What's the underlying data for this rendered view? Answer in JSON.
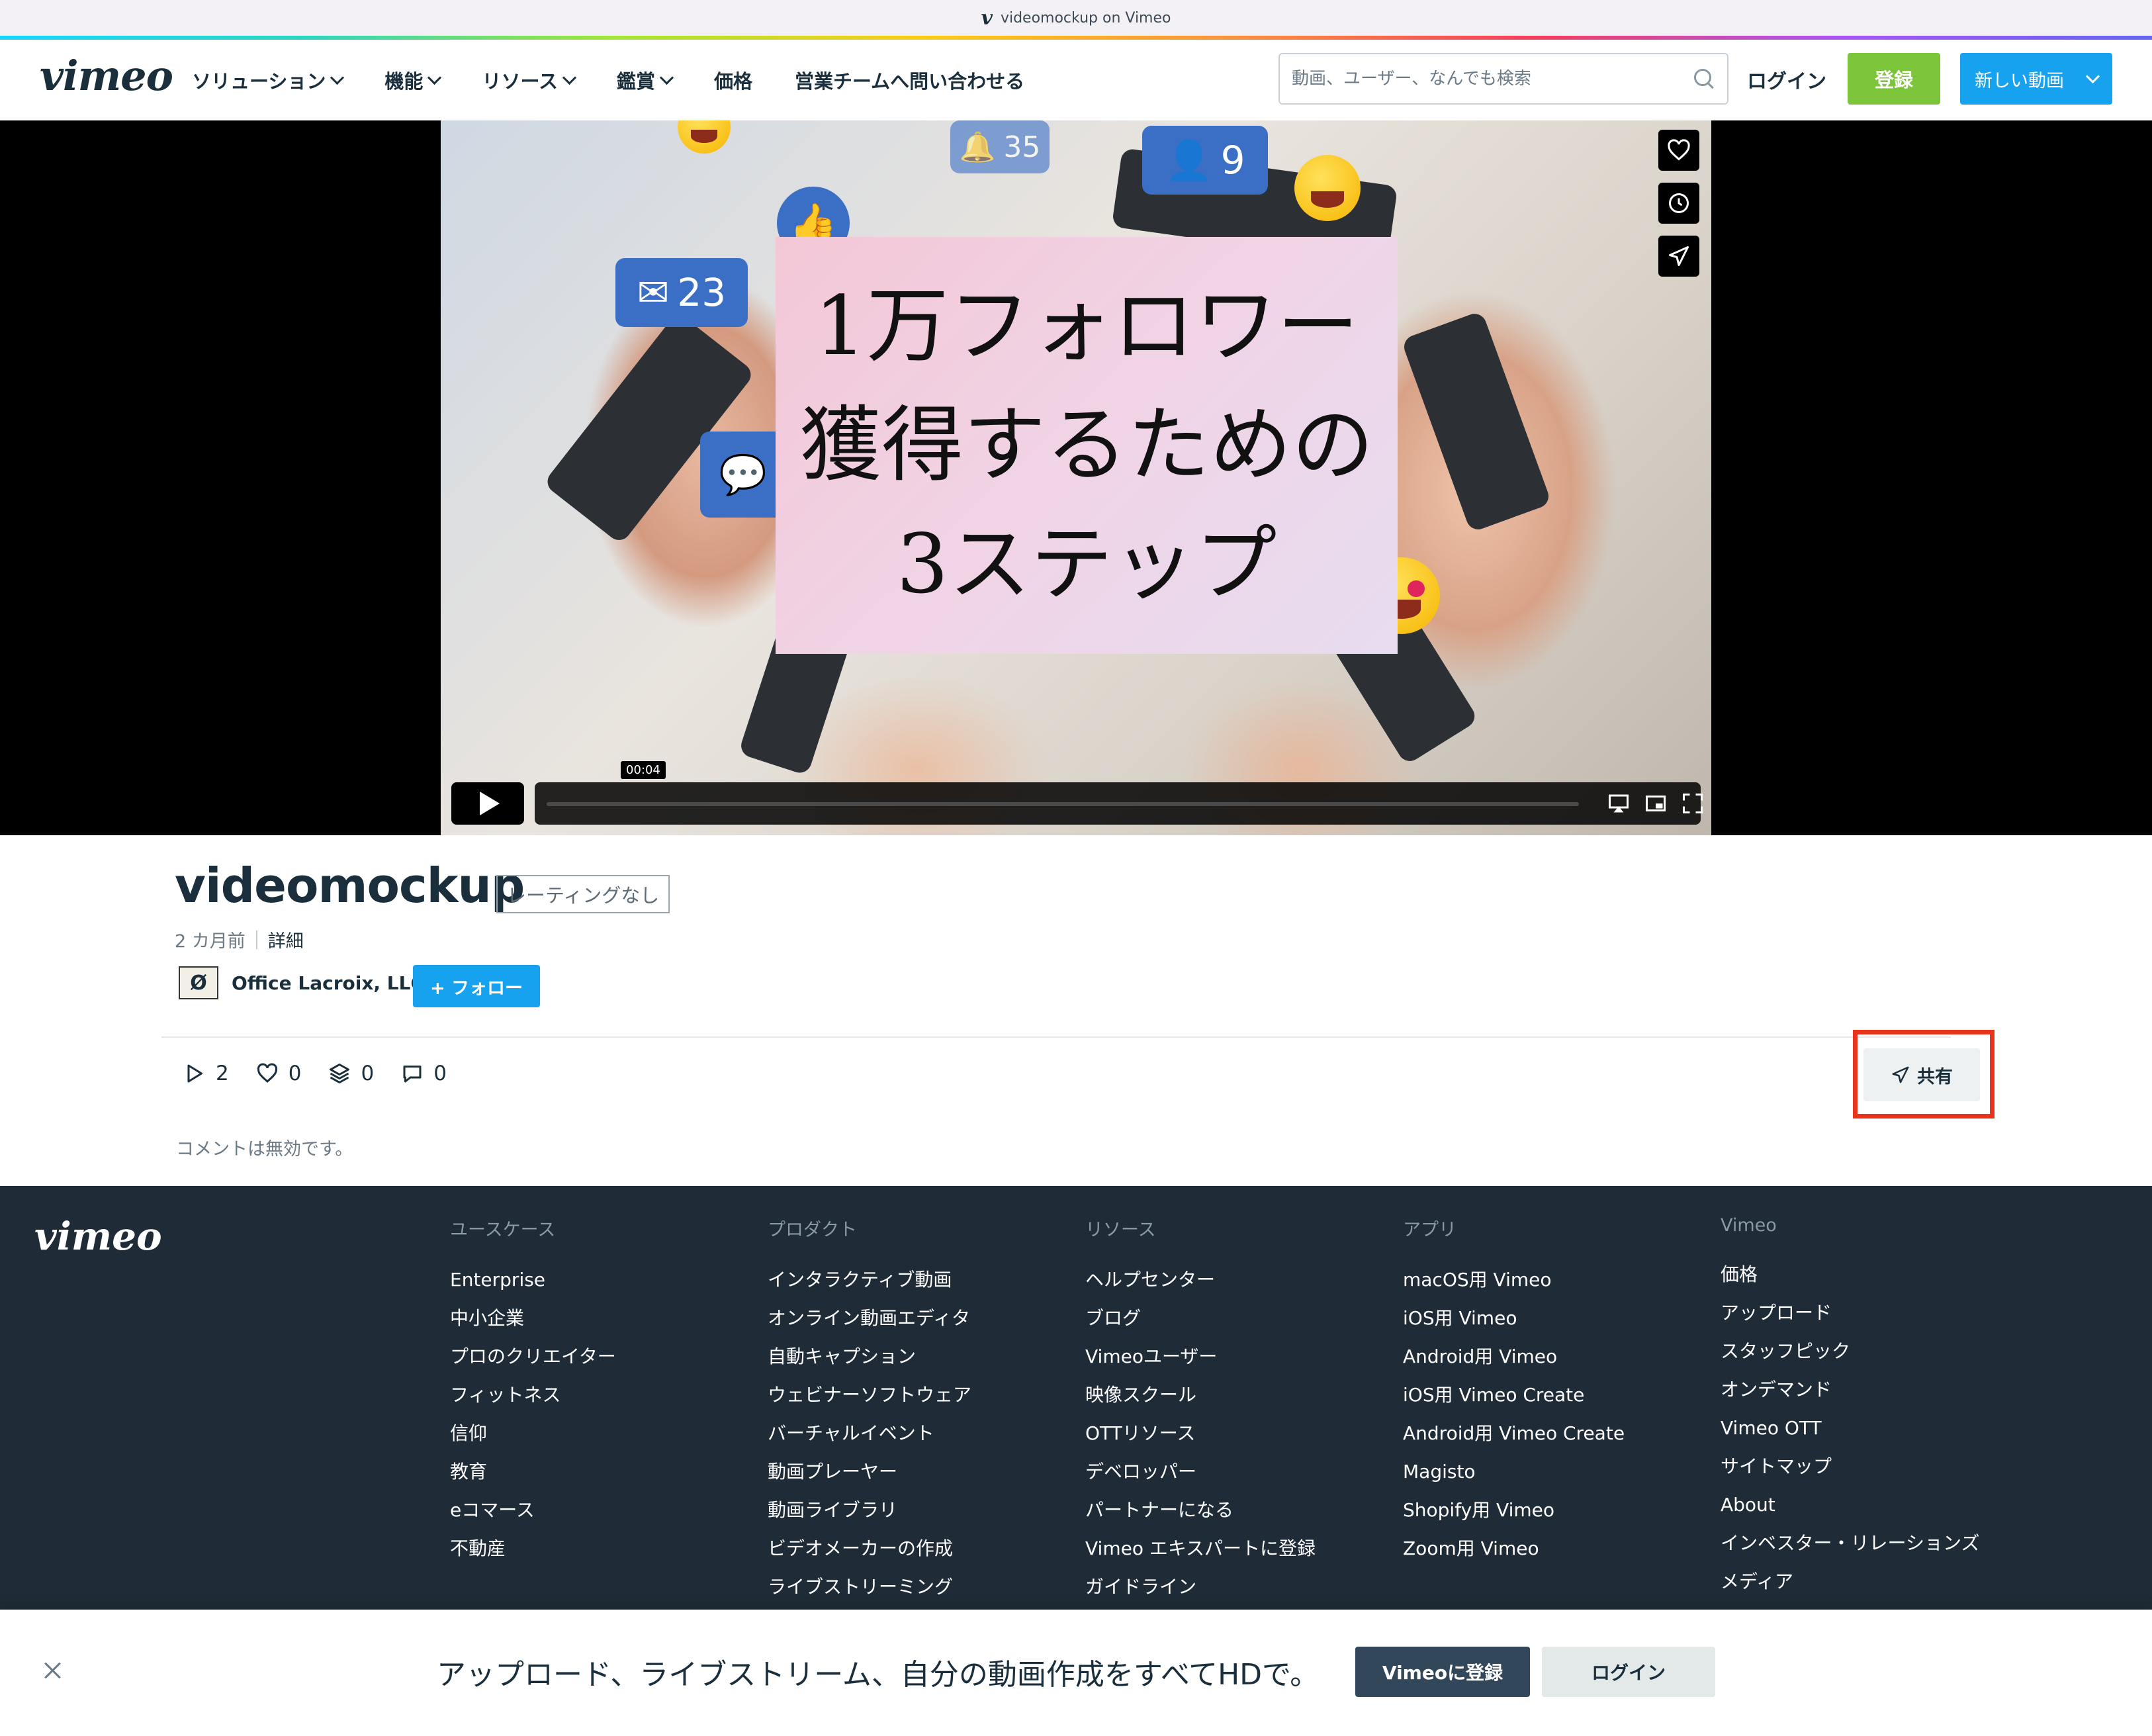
{
  "browser": {
    "title": "videomockup on Vimeo"
  },
  "nav": {
    "logo": "vimeo",
    "menu": [
      {
        "label": "ソリューション",
        "dropdown": true
      },
      {
        "label": "機能",
        "dropdown": true
      },
      {
        "label": "リソース",
        "dropdown": true
      },
      {
        "label": "鑑賞",
        "dropdown": true
      },
      {
        "label": "価格",
        "dropdown": false
      },
      {
        "label": "営業チームへ問い合わせる",
        "dropdown": false
      }
    ],
    "search_placeholder": "動画、ユーザー、なんでも検索",
    "login": "ログイン",
    "register": "登録",
    "new_video": "新しい動画"
  },
  "video": {
    "overlay_lines": [
      "1万フォロワー",
      "獲得するための",
      "3ステップ"
    ],
    "bubble_mail_count": "23",
    "bubble_people_count": "9",
    "bubble_bell_count": "35",
    "current_time": "00:04",
    "progress": 0.0
  },
  "info": {
    "title": "videomockup",
    "rating": "レーティングなし",
    "age": "2 カ月前",
    "details": "詳細",
    "owner": "Office Lacroix, LLC",
    "follow": "+ フォロー",
    "stats": {
      "plays": "2",
      "likes": "0",
      "collections": "0",
      "comments": "0"
    },
    "share": "共有",
    "comments_disabled": "コメントは無効です。"
  },
  "footer": {
    "logo": "vimeo",
    "columns": [
      {
        "heading": "ユースケース",
        "links": [
          "Enterprise",
          "中小企業",
          "プロのクリエイター",
          "フィットネス",
          "信仰",
          "教育",
          "eコマース",
          "不動産"
        ]
      },
      {
        "heading": "プロダクト",
        "links": [
          "インタラクティブ動画",
          "オンライン動画エディタ",
          "自動キャプション",
          "ウェビナーソフトウェア",
          "バーチャルイベント",
          "動画プレーヤー",
          "動画ライブラリ",
          "ビデオメーカーの作成",
          "ライブストリーミング"
        ]
      },
      {
        "heading": "リソース",
        "links": [
          "ヘルプセンター",
          "ブログ",
          "Vimeoユーザー",
          "映像スクール",
          "OTTリソース",
          "デベロッパー",
          "パートナーになる",
          "Vimeo エキスパートに登録",
          "ガイドライン"
        ]
      },
      {
        "heading": "アプリ",
        "links": [
          "macOS用 Vimeo",
          "iOS用 Vimeo",
          "Android用 Vimeo",
          "iOS用 Vimeo Create",
          "Android用 Vimeo Create",
          "Magisto",
          "Shopify用 Vimeo",
          "Zoom用 Vimeo"
        ]
      },
      {
        "heading": "Vimeo",
        "links": [
          "価格",
          "アップロード",
          "スタッフピック",
          "オンデマンド",
          "Vimeo OTT",
          "サイトマップ",
          "About",
          "インベスター・リレーションズ",
          "メディア"
        ]
      }
    ]
  },
  "banner": {
    "message": "アップロード、ライブストリーム、自分の動画作成をすべてHDで。",
    "register": "Vimeoに登録",
    "login": "ログイン"
  },
  "colors": {
    "brand_blue": "#17a2f0",
    "register_green": "#7cc43a",
    "footer_bg": "#1f2b36",
    "highlight_red": "#e8341c"
  }
}
